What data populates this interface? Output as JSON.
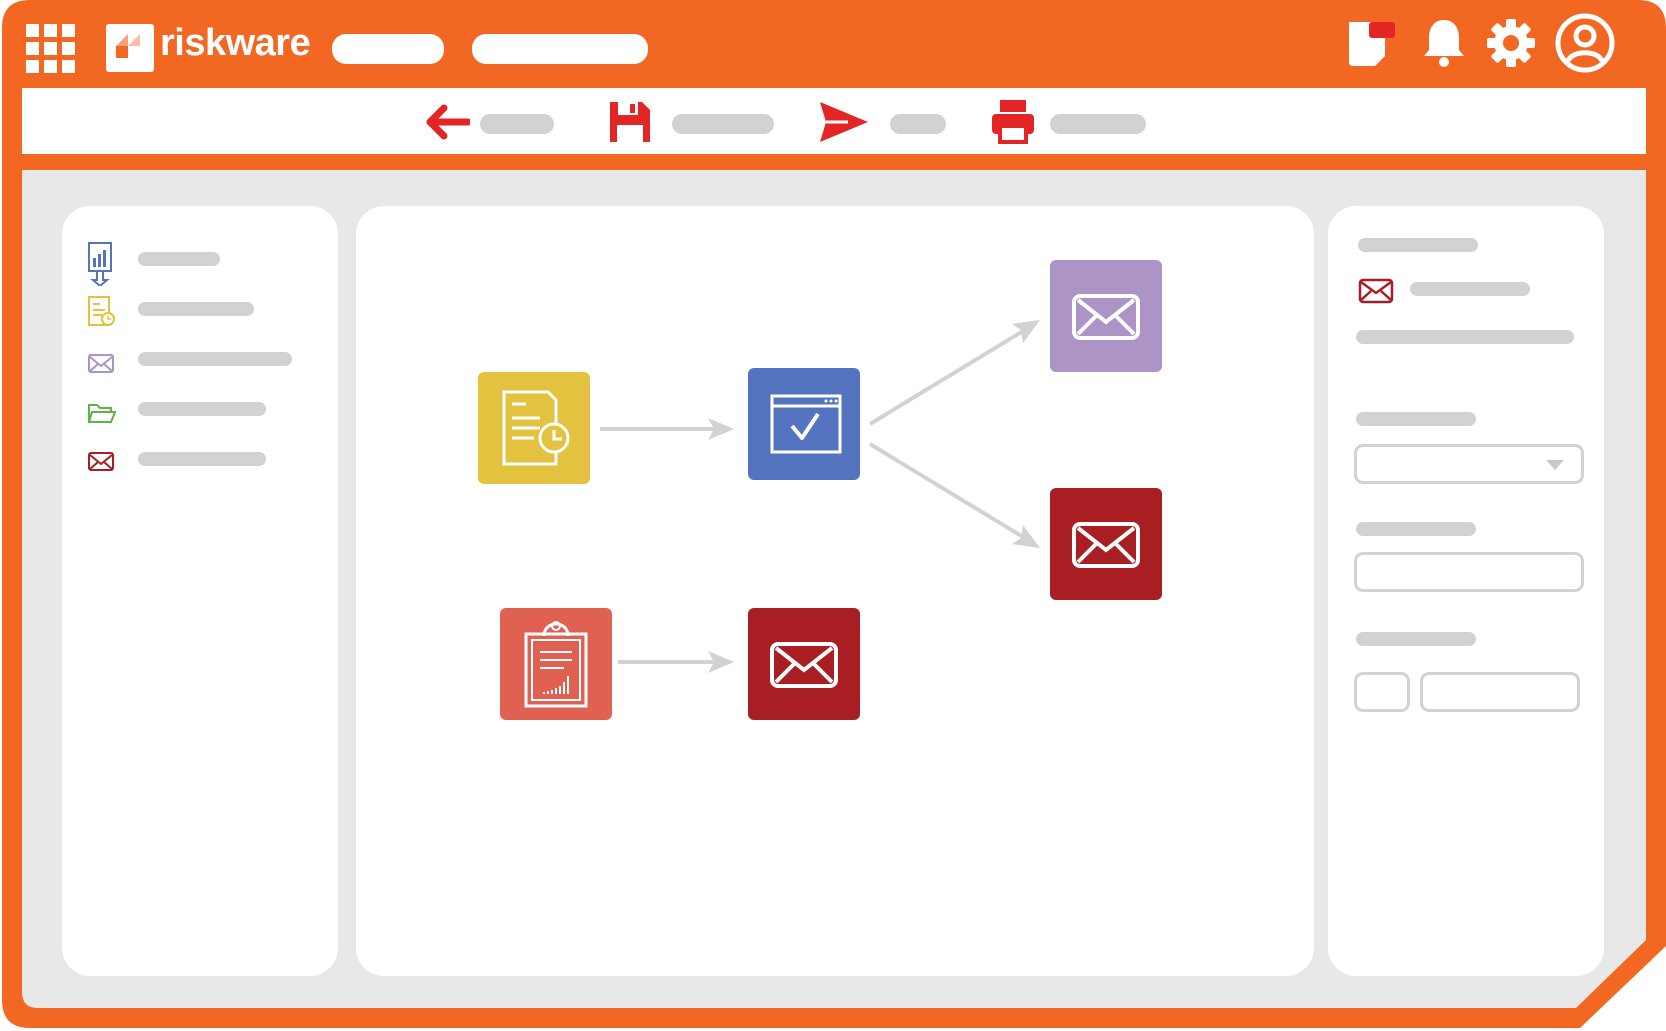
{
  "app": {
    "name": "riskware"
  },
  "colors": {
    "brand_orange": "#f26822",
    "frame_inner": "#e7e8e7",
    "toolbar_icon_red": "#e32526",
    "placeholder_grey": "#d2d2d2",
    "tile_yellow": "#e2c23e",
    "tile_blue": "#5474bf",
    "tile_purple": "#ac94c6",
    "tile_dark_red": "#a81e22",
    "tile_coral": "#e06052"
  },
  "header": {
    "icons": [
      "apps-grid-icon",
      "riskware-logo",
      "notes-icon",
      "bell-icon",
      "gear-icon",
      "user-account-icon"
    ]
  },
  "toolbar": {
    "actions": [
      "back-arrow-icon",
      "save-icon",
      "send-icon",
      "print-icon"
    ]
  },
  "sidebar": {
    "items": [
      "report-download-icon",
      "scheduled-document-icon",
      "mail-purple-icon",
      "folder-open-icon",
      "mail-red-icon"
    ]
  },
  "workflow": {
    "nodes": [
      "scheduled-report",
      "approval-window",
      "email-purple",
      "email-red",
      "clipboard-report",
      "email-red"
    ]
  },
  "properties": {
    "icon": "mail-red-icon",
    "fields": [
      "dropdown",
      "text-field",
      "small-field",
      "wide-field"
    ]
  }
}
